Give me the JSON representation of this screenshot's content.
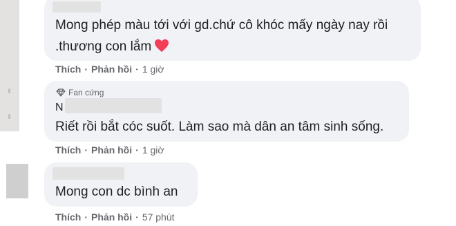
{
  "comments": [
    {
      "text_line1": "Mong phép màu tới với gd.chứ cô khóc mấy ngày nay rồi",
      "text_line2": ".thương con lắm",
      "like": "Thích",
      "reply": "Phản hồi",
      "separator": "·",
      "time": "1 giờ",
      "emoji": "red-heart"
    },
    {
      "badge": "Fan cứng",
      "name_visible_start": "N",
      "text": "Riết rồi bắt cóc suốt. Làm sao mà dân an tâm sinh sống.",
      "like": "Thích",
      "reply": "Phản hồi",
      "separator": "·",
      "time": "1 giờ"
    },
    {
      "text": "Mong con dc bình an",
      "like": "Thích",
      "reply": "Phản hồi",
      "separator": "·",
      "time": "57 phút"
    }
  ],
  "colors": {
    "bubble": "#f0f2f5",
    "text": "#1c1e21",
    "secondary": "#65676b",
    "heart": "#f33e58"
  }
}
